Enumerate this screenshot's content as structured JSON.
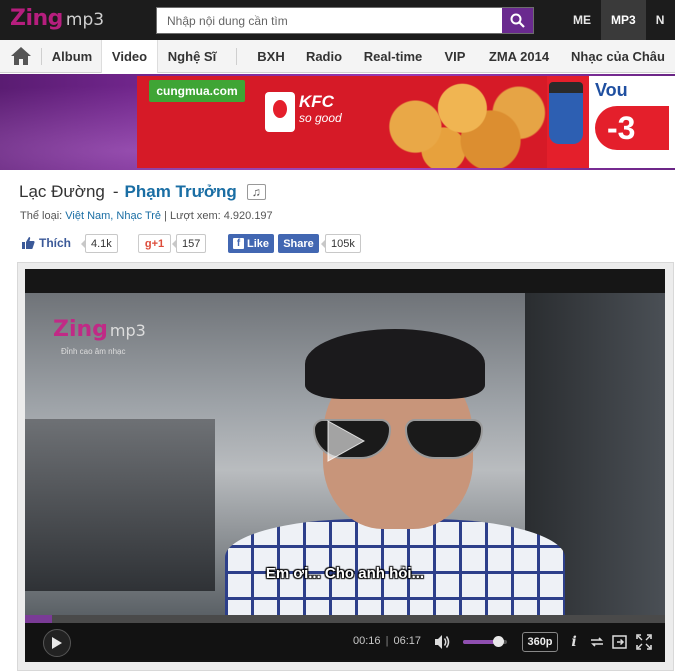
{
  "header": {
    "logo_main": "Zing",
    "logo_sub": "mp3",
    "search_placeholder": "Nhập nội dung cần tìm",
    "top_tabs": [
      {
        "label": "ME"
      },
      {
        "label": "MP3"
      },
      {
        "label": "N"
      }
    ]
  },
  "nav": {
    "items": [
      {
        "label": "Album"
      },
      {
        "label": "Video"
      },
      {
        "label": "Nghệ Sĩ"
      },
      {
        "label": "BXH"
      },
      {
        "label": "Radio"
      },
      {
        "label": "Real-time"
      },
      {
        "label": "VIP"
      },
      {
        "label": "ZMA 2014"
      },
      {
        "label": "Nhạc của Châu"
      }
    ],
    "active": "Video"
  },
  "ad": {
    "site": "cungmua.com",
    "kfc_mark": "KFC",
    "brand": "KFC",
    "slogan": "so good",
    "right_text": "Vou",
    "percent": "-3"
  },
  "song": {
    "title": "Lạc Đường",
    "separator": "-",
    "artist": "Phạm Trưởng",
    "music_icon": "♫",
    "genre_label": "Thể loại:",
    "genres": "Việt Nam, Nhạc Trẻ",
    "views_label": "| Lượt xem:",
    "views": "4.920.197"
  },
  "social": {
    "like_label": "Thích",
    "like_count": "4.1k",
    "gplus_label": "+1",
    "gplus_count": "157",
    "fb_like_label": "Like",
    "fb_share_label": "Share",
    "fb_count": "105k"
  },
  "player": {
    "watermark_main": "Zing",
    "watermark_sub": "mp3",
    "watermark_tag": "Đỉnh cao âm nhạc",
    "subtitle": "Em ơi... Cho anh hỏi...",
    "current_time": "00:16",
    "time_separator": "|",
    "duration": "06:17",
    "progress": 0.042,
    "volume": 0.8,
    "quality": "360p"
  },
  "colors": {
    "brand_purple": "#6a2a8f",
    "zing_magenta": "#b61e7e",
    "link_blue": "#1a6ea4",
    "fb_blue": "#4267b2"
  }
}
